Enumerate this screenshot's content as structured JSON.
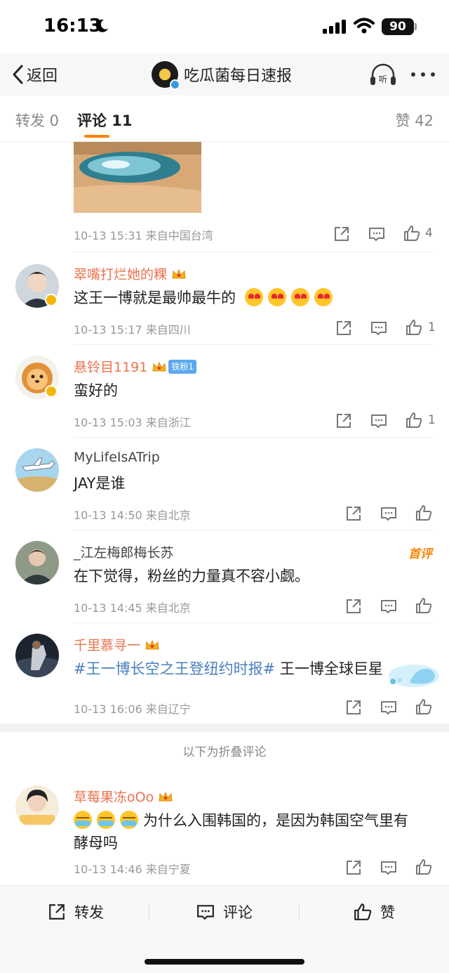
{
  "status": {
    "time": "16:13",
    "battery": "90"
  },
  "nav": {
    "back_label": "返回",
    "title": "吃瓜菌每日速报"
  },
  "tabs": {
    "repost": "转发 0",
    "comments": "评论 11",
    "likes": "赞 42"
  },
  "top_item": {
    "meta": "10-13 15:31 来自中国台湾",
    "like_count": "4"
  },
  "comments": [
    {
      "user": "翠嘴打烂她的粿",
      "text": "这王一博就是最帅最牛的",
      "emoji": "heart-eyes-emoji",
      "emoji_count": 4,
      "meta": "10-13 15:17 来自四川",
      "like_count": "1"
    },
    {
      "user": "悬铃目1191",
      "fan_badge": "铁粉1",
      "text": "蛮好的",
      "meta": "10-13 15:03 来自浙江",
      "like_count": "1"
    },
    {
      "user": "MyLifeIsATrip",
      "text": "JAY是谁",
      "meta": "10-13 14:50 来自北京"
    },
    {
      "user": "_江左梅郎梅长苏",
      "badge": "首评",
      "text": "在下觉得，粉丝的力量真不容小觑。",
      "meta": "10-13 14:45 来自北京"
    },
    {
      "user": "千里慕寻一",
      "topic": "#王一博长空之王登纽约时报#",
      "text": " 王一博全球巨星",
      "meta": "10-13 16:06 来自辽宁"
    }
  ],
  "folded_label": "以下为折叠评论",
  "folded_comments": [
    {
      "user": "草莓果冻oOo",
      "emoji": "crying-laughing-emoji",
      "emoji_count": 3,
      "text_line1": "为什么入围韩国的，是因为韩国空气里有",
      "text_line2": "酵母吗",
      "meta": "10-13 14:46 来自宁夏"
    }
  ],
  "bottom_bar": {
    "repost": "转发",
    "comment": "评论",
    "like": "赞"
  },
  "colors": {
    "accent": "#ff8200",
    "username": "#eb7350",
    "topic": "#4a7fbd",
    "meta": "#999999"
  }
}
